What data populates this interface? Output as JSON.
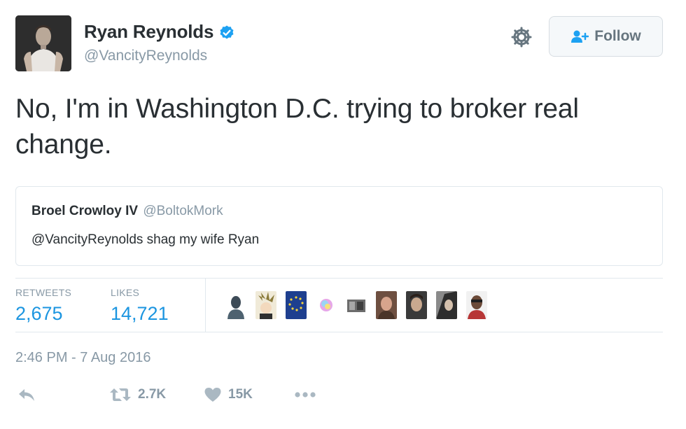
{
  "author": {
    "name": "Ryan Reynolds",
    "handle": "@VancityReynolds",
    "verified": true
  },
  "header": {
    "follow_label": "Follow",
    "settings_icon": "gear-icon",
    "follow_icon": "user-plus-icon"
  },
  "tweet": {
    "text": "No, I'm in Washington D.C. trying to broker real change."
  },
  "quoted_tweet": {
    "name": "Broel Crowloy IV",
    "handle": "@BoltokMork",
    "text": "@VancityReynolds shag my wife Ryan"
  },
  "stats": {
    "retweets_label": "RETWEETS",
    "retweets_value": "2,675",
    "likes_label": "LIKES",
    "likes_value": "14,721"
  },
  "timestamp": "2:46 PM - 7 Aug 2016",
  "actions": {
    "reply_icon": "reply-icon",
    "retweet_icon": "retweet-icon",
    "retweet_count": "2.7K",
    "like_icon": "heart-icon",
    "like_count": "15K",
    "more_icon": "more-dots-icon"
  },
  "colors": {
    "accent": "#1b95e0",
    "verified": "#1da1f2",
    "muted": "#8899a6",
    "text": "#292f33",
    "border": "#e1e8ed"
  }
}
